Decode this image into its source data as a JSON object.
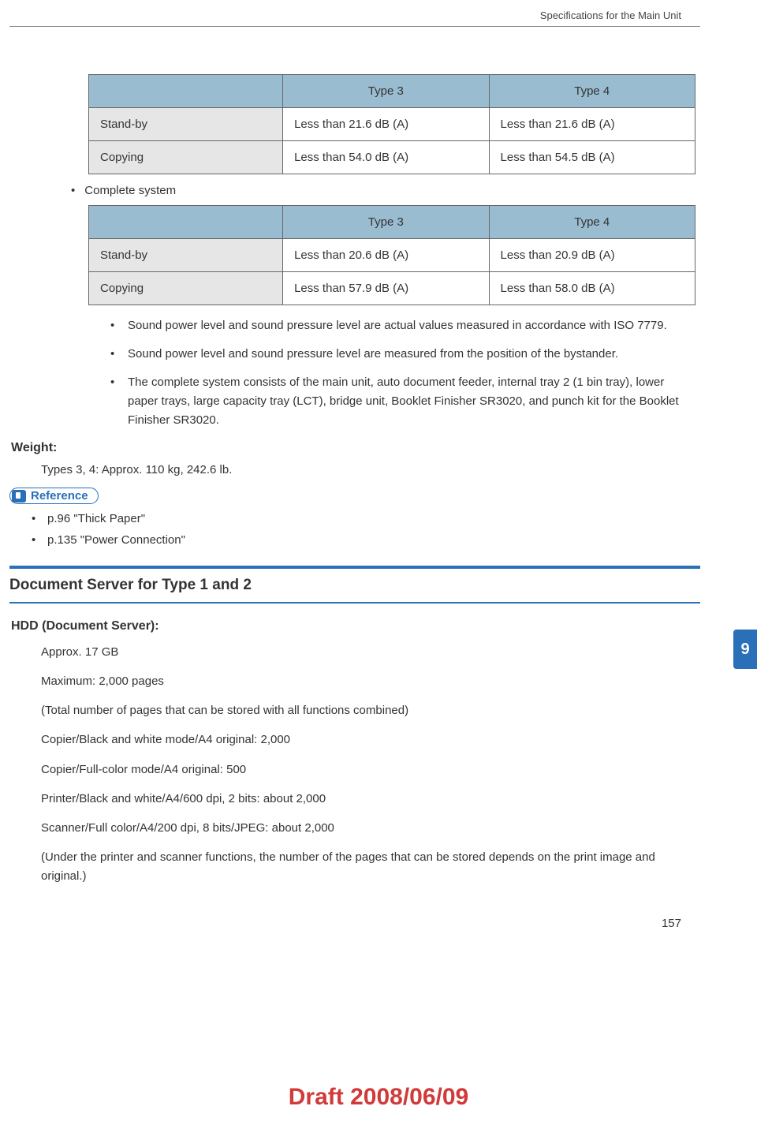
{
  "header": {
    "title": "Specifications for the Main Unit"
  },
  "table1": {
    "head_col2": "Type 3",
    "head_col3": "Type 4",
    "rows": [
      {
        "label": "Stand-by",
        "c2": "Less than 21.6 dB (A)",
        "c3": "Less than 21.6 dB (A)"
      },
      {
        "label": "Copying",
        "c2": "Less than 54.0 dB (A)",
        "c3": "Less than 54.5 dB (A)"
      }
    ]
  },
  "complete_system_label": "Complete system",
  "table2": {
    "head_col2": "Type 3",
    "head_col3": "Type 4",
    "rows": [
      {
        "label": "Stand-by",
        "c2": "Less than 20.6 dB (A)",
        "c3": "Less than 20.9 dB (A)"
      },
      {
        "label": "Copying",
        "c2": "Less than 57.9 dB (A)",
        "c3": "Less than 58.0 dB (A)"
      }
    ]
  },
  "notes": [
    "Sound power level and sound pressure level are actual values measured in accordance with ISO 7779.",
    "Sound power level and sound pressure level are measured from the position of the bystander.",
    "The complete system consists of the main unit, auto document feeder, internal tray 2 (1 bin tray), lower paper trays, large capacity tray (LCT), bridge unit, Booklet Finisher SR3020, and punch kit for the Booklet Finisher SR3020."
  ],
  "weight": {
    "label": "Weight:",
    "value": "Types 3, 4: Approx. 110 kg, 242.6 lb."
  },
  "reference": {
    "badge": "Reference",
    "items": [
      "p.96 \"Thick Paper\"",
      "p.135 \"Power Connection\""
    ]
  },
  "section_title": "Document Server for Type 1 and 2",
  "hdd": {
    "title": "HDD (Document Server):",
    "lines": [
      "Approx. 17 GB",
      "Maximum: 2,000 pages",
      "(Total number of pages that can be stored with all functions combined)",
      "Copier/Black and white mode/A4 original: 2,000",
      "Copier/Full-color mode/A4 original: 500",
      "Printer/Black and white/A4/600 dpi, 2 bits: about 2,000",
      "Scanner/Full color/A4/200 dpi, 8 bits/JPEG: about 2,000",
      "(Under the printer and scanner functions, the number of the pages that can be stored depends on the print image and original.)"
    ]
  },
  "side_tab": "9",
  "page_number": "157",
  "draft": "Draft 2008/06/09"
}
